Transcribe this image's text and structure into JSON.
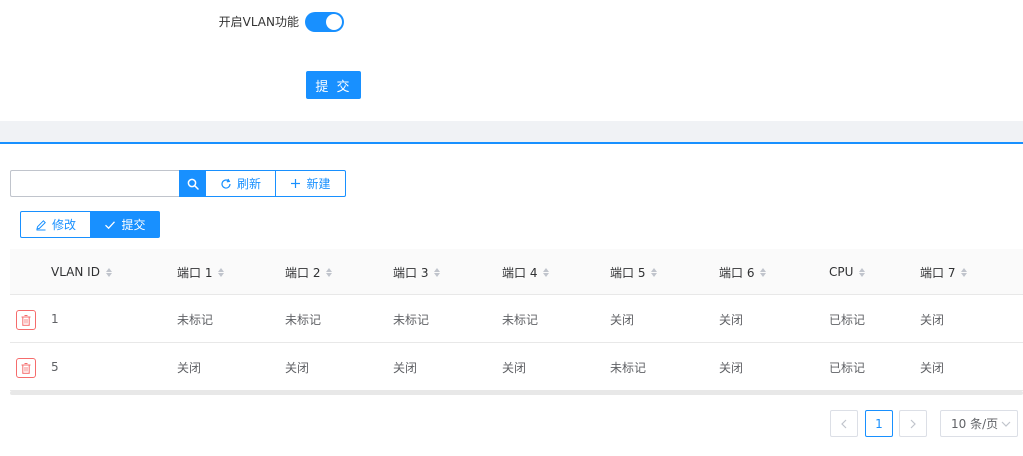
{
  "form": {
    "vlan_label": "开启VLAN功能",
    "vlan_enabled": true,
    "submit_label": "提 交"
  },
  "toolbar": {
    "search_placeholder": "",
    "search_value": "",
    "refresh_label": "刷新",
    "new_label": "新建",
    "edit_label": "修改",
    "commit_label": "提交"
  },
  "table": {
    "columns": [
      "VLAN ID",
      "端口 1",
      "端口 2",
      "端口 3",
      "端口 4",
      "端口 5",
      "端口 6",
      "CPU",
      "端口 7"
    ],
    "rows": [
      [
        "1",
        "未标记",
        "未标记",
        "未标记",
        "未标记",
        "关闭",
        "关闭",
        "已标记",
        "关闭"
      ],
      [
        "5",
        "关闭",
        "关闭",
        "关闭",
        "关闭",
        "未标记",
        "关闭",
        "已标记",
        "关闭"
      ]
    ]
  },
  "pagination": {
    "current_page": "1",
    "page_size": "10 条/页"
  },
  "colors": {
    "accent": "#1890ff",
    "danger": "#f56c6c",
    "band": "#f0f2f5"
  },
  "icons": [
    "search-icon",
    "refresh-icon",
    "plus-icon",
    "edit-icon",
    "check-icon",
    "delete-icon",
    "chevron-left-icon",
    "chevron-right-icon",
    "chevron-down-icon"
  ]
}
